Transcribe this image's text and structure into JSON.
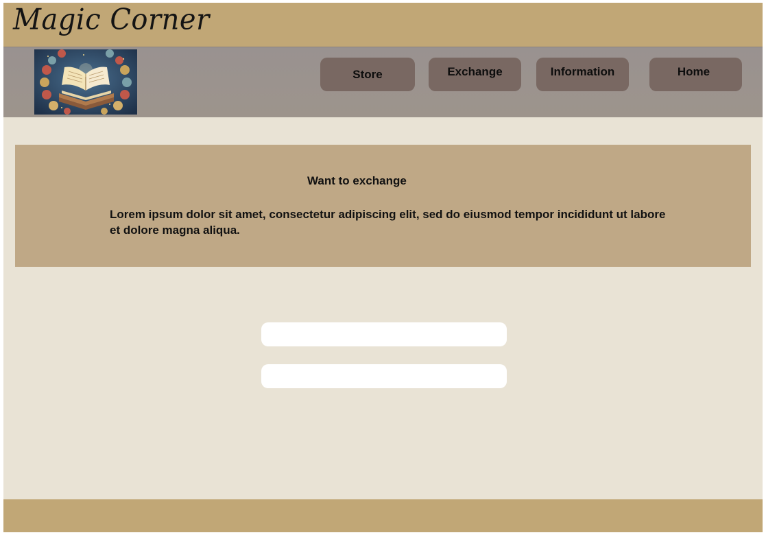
{
  "header": {
    "logo_text": "Magic Corner"
  },
  "nav": {
    "items": [
      {
        "label": "Store"
      },
      {
        "label": "Exchange"
      },
      {
        "label": "Information"
      },
      {
        "label": "Home"
      }
    ]
  },
  "banner": {
    "title": "Want to exchange",
    "text": "Lorem ipsum dolor sit amet, consectetur adipiscing elit, sed do eiusmod tempor incididunt ut labore et dolore magna aliqua."
  },
  "form": {
    "field1": {
      "value": "",
      "placeholder": ""
    },
    "field2": {
      "value": "",
      "placeholder": ""
    }
  },
  "colors": {
    "topbar": "#c1a776",
    "navbar": "#9a928c",
    "nav_button": "#796862",
    "page_background": "#e9e3d5",
    "banner": "#bfa886",
    "footer": "#c1a776"
  },
  "icons": {
    "brand_image": "open-book-illustration"
  }
}
